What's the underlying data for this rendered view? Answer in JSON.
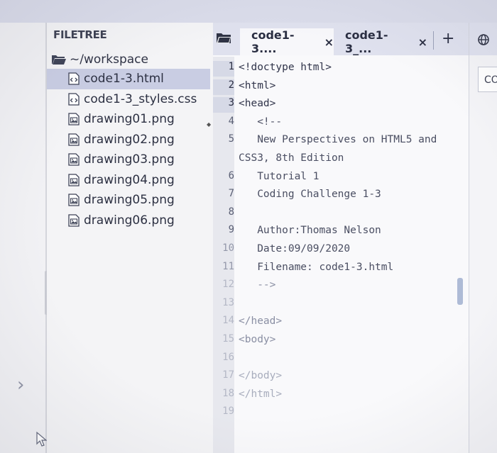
{
  "filetree": {
    "title": "FILETREE",
    "root_label": "~/workspace",
    "files": [
      {
        "name": "code1-3.html",
        "type": "html",
        "selected": true
      },
      {
        "name": "code1-3_styles.css",
        "type": "css",
        "selected": false
      },
      {
        "name": "drawing01.png",
        "type": "image",
        "selected": false
      },
      {
        "name": "drawing02.png",
        "type": "image",
        "selected": false
      },
      {
        "name": "drawing03.png",
        "type": "image",
        "selected": false
      },
      {
        "name": "drawing04.png",
        "type": "image",
        "selected": false
      },
      {
        "name": "drawing05.png",
        "type": "image",
        "selected": false
      },
      {
        "name": "drawing06.png",
        "type": "image",
        "selected": false
      }
    ]
  },
  "editor": {
    "tabs": [
      {
        "label": "code1-3....",
        "close": "×",
        "active": true
      },
      {
        "label": "code1-3_...",
        "close": "×",
        "active": false
      }
    ],
    "new_tab": "+",
    "lines": [
      {
        "n": "1",
        "text": "<!doctype html>"
      },
      {
        "n": "2",
        "text": "<html>"
      },
      {
        "n": "3",
        "text": "<head>"
      },
      {
        "n": "4",
        "text": "   <!--"
      },
      {
        "n": "5",
        "text": "   New Perspectives on HTML5 and"
      },
      {
        "n": "",
        "text": "CSS3, 8th Edition"
      },
      {
        "n": "6",
        "text": "   Tutorial 1"
      },
      {
        "n": "7",
        "text": "   Coding Challenge 1-3"
      },
      {
        "n": "8",
        "text": ""
      },
      {
        "n": "9",
        "text": "   Author:Thomas Nelson"
      },
      {
        "n": "10",
        "text": "   Date:09/09/2020"
      },
      {
        "n": "11",
        "text": "   Filename: code1-3.html"
      },
      {
        "n": "12",
        "text": "   -->"
      },
      {
        "n": "13",
        "text": ""
      },
      {
        "n": "14",
        "text": "</head>"
      },
      {
        "n": "15",
        "text": "<body>"
      },
      {
        "n": "16",
        "text": ""
      },
      {
        "n": "17",
        "text": "</body>"
      },
      {
        "n": "18",
        "text": "</html>"
      },
      {
        "n": "19",
        "text": ""
      }
    ]
  },
  "right_panel": {
    "button_label": "CO"
  },
  "colors": {
    "selected_row": "#c9cde3",
    "tabbar": "#dfe1ee",
    "scroll_thumb": "#aebbd6"
  }
}
